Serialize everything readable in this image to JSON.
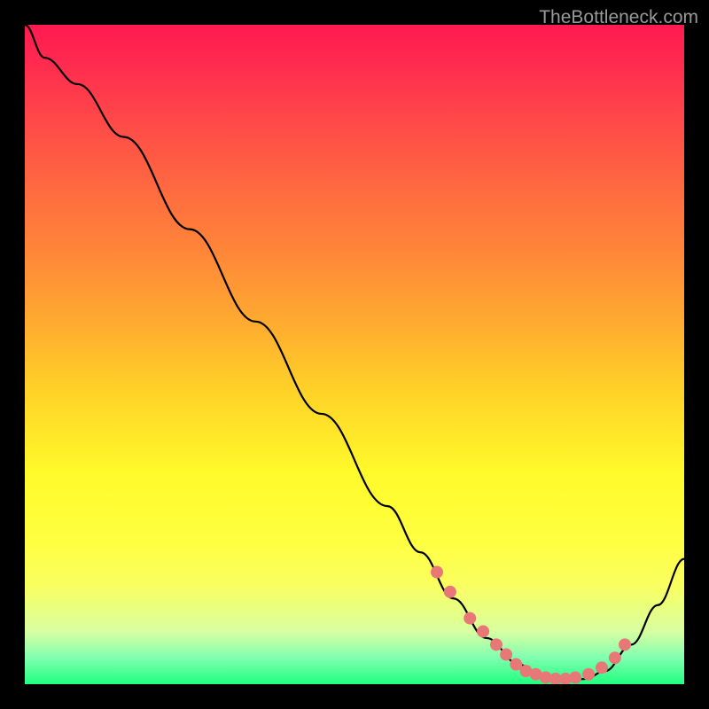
{
  "watermark": "TheBottleneck.com",
  "chart_data": {
    "type": "line",
    "title": "",
    "xlabel": "",
    "ylabel": "",
    "xlim": [
      0,
      100
    ],
    "ylim": [
      0,
      100
    ],
    "series": [
      {
        "name": "curve",
        "x": [
          0,
          3,
          8,
          15,
          25,
          35,
          45,
          55,
          60,
          65,
          70,
          75,
          78,
          80,
          82,
          85,
          88,
          92,
          96,
          100
        ],
        "y": [
          100,
          95,
          91,
          83,
          69,
          55,
          41,
          27,
          20,
          13,
          7,
          3,
          1,
          0.5,
          0.5,
          0.8,
          2,
          6,
          12,
          19
        ]
      }
    ],
    "highlight_points": {
      "x": [
        62.5,
        64.5,
        67.5,
        69.5,
        71.5,
        73,
        74.5,
        76,
        77.5,
        79,
        80.5,
        82,
        83.5,
        85.5,
        87.5,
        89.5,
        91
      ],
      "y": [
        17,
        14,
        10,
        8,
        6,
        4.5,
        3,
        2,
        1.5,
        1,
        0.8,
        0.8,
        1,
        1.5,
        2.5,
        4,
        6
      ]
    }
  }
}
